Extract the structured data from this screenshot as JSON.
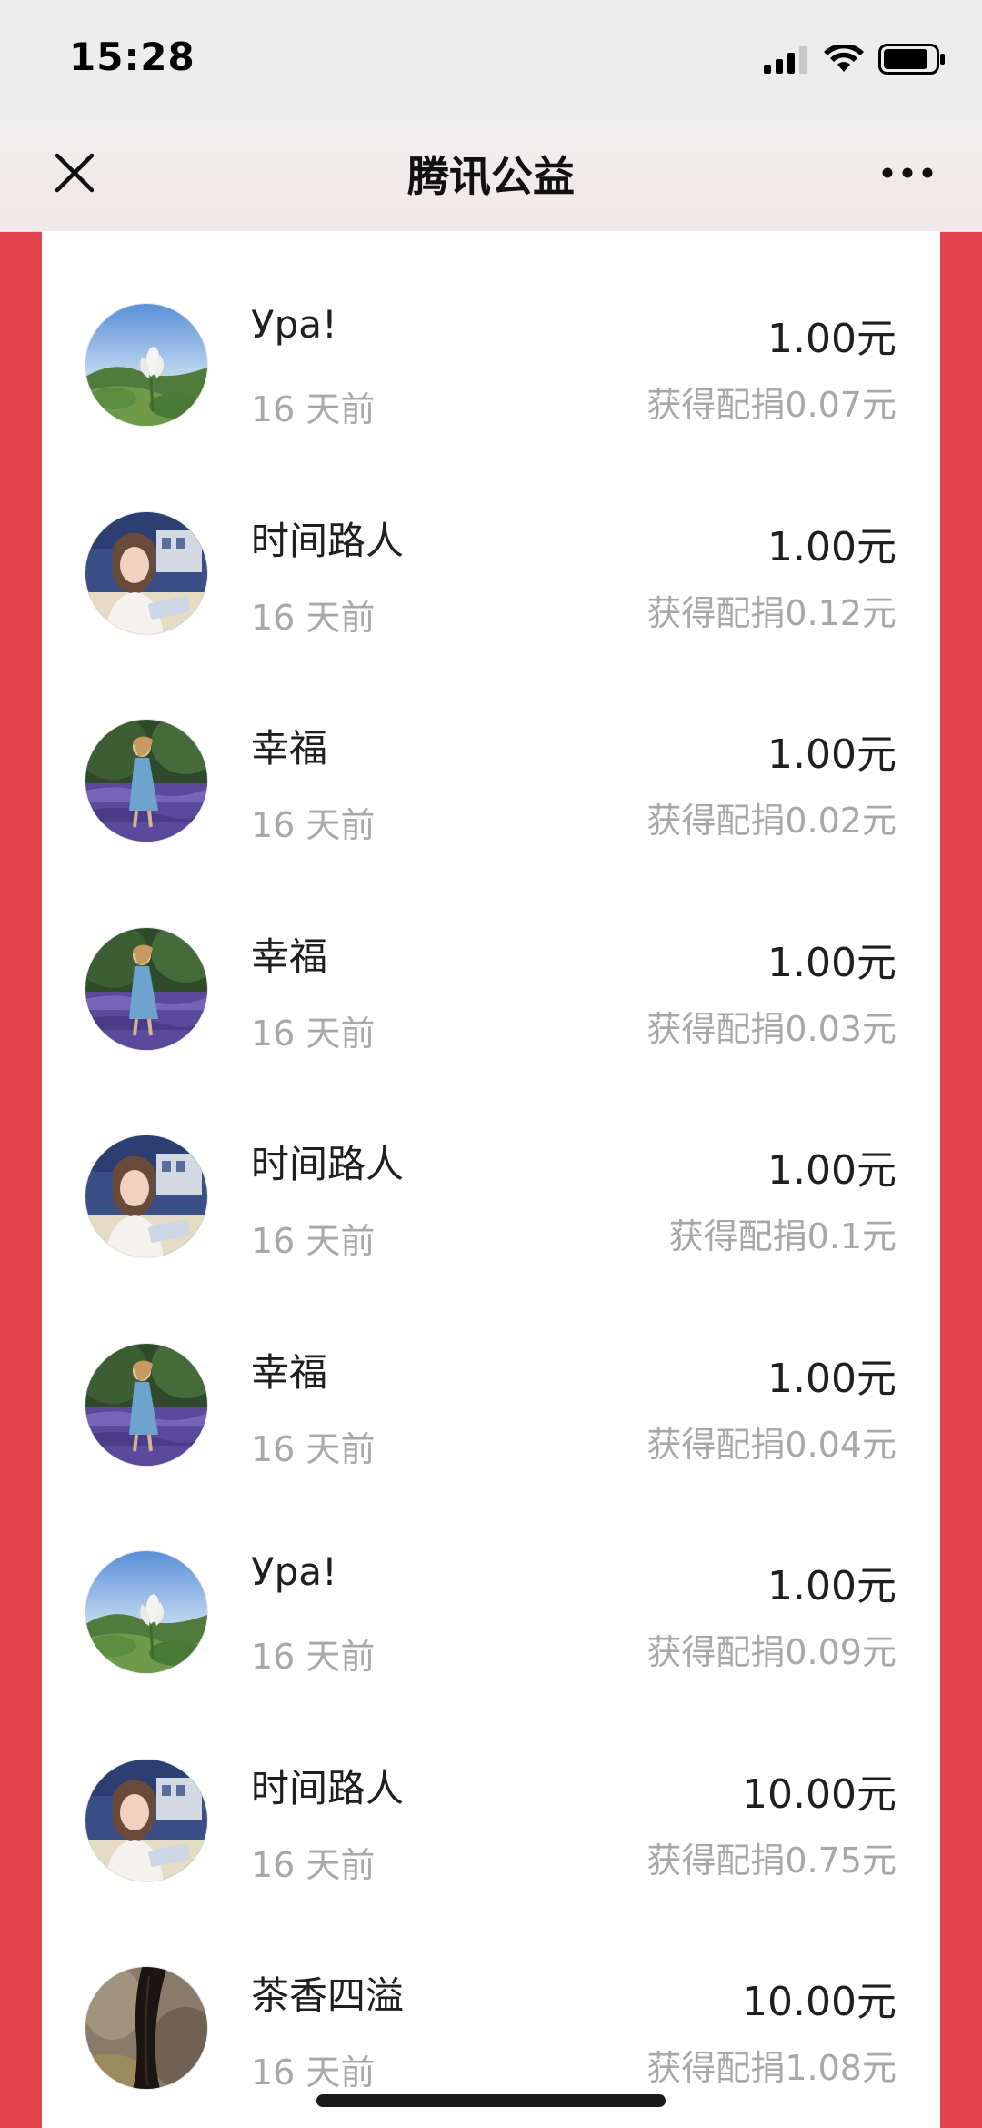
{
  "status_bar": {
    "time": "15:28"
  },
  "nav": {
    "title": "腾讯公益",
    "close_icon": "close-icon",
    "more_icon": "more-icon"
  },
  "colors": {
    "brand_red": "#e0434b",
    "text_primary": "#1f1f1f",
    "text_secondary": "#a8a8a8"
  },
  "donations": [
    {
      "name": "Ура!",
      "time": "16 天前",
      "amount": "1.00元",
      "match": "获得配捐0.07元",
      "avatar": "lotus"
    },
    {
      "name": "时间路人",
      "time": "16 天前",
      "amount": "1.00元",
      "match": "获得配捐0.12元",
      "avatar": "woman"
    },
    {
      "name": "幸福",
      "time": "16 天前",
      "amount": "1.00元",
      "match": "获得配捐0.02元",
      "avatar": "lavender"
    },
    {
      "name": "幸福",
      "time": "16 天前",
      "amount": "1.00元",
      "match": "获得配捐0.03元",
      "avatar": "lavender"
    },
    {
      "name": "时间路人",
      "time": "16 天前",
      "amount": "1.00元",
      "match": "获得配捐0.1元",
      "avatar": "woman"
    },
    {
      "name": "幸福",
      "time": "16 天前",
      "amount": "1.00元",
      "match": "获得配捐0.04元",
      "avatar": "lavender"
    },
    {
      "name": "Ура!",
      "time": "16 天前",
      "amount": "1.00元",
      "match": "获得配捐0.09元",
      "avatar": "lotus"
    },
    {
      "name": "时间路人",
      "time": "16 天前",
      "amount": "10.00元",
      "match": "获得配捐0.75元",
      "avatar": "woman"
    },
    {
      "name": "茶香四溢",
      "time": "16 天前",
      "amount": "10.00元",
      "match": "获得配捐1.08元",
      "avatar": "hair"
    }
  ]
}
